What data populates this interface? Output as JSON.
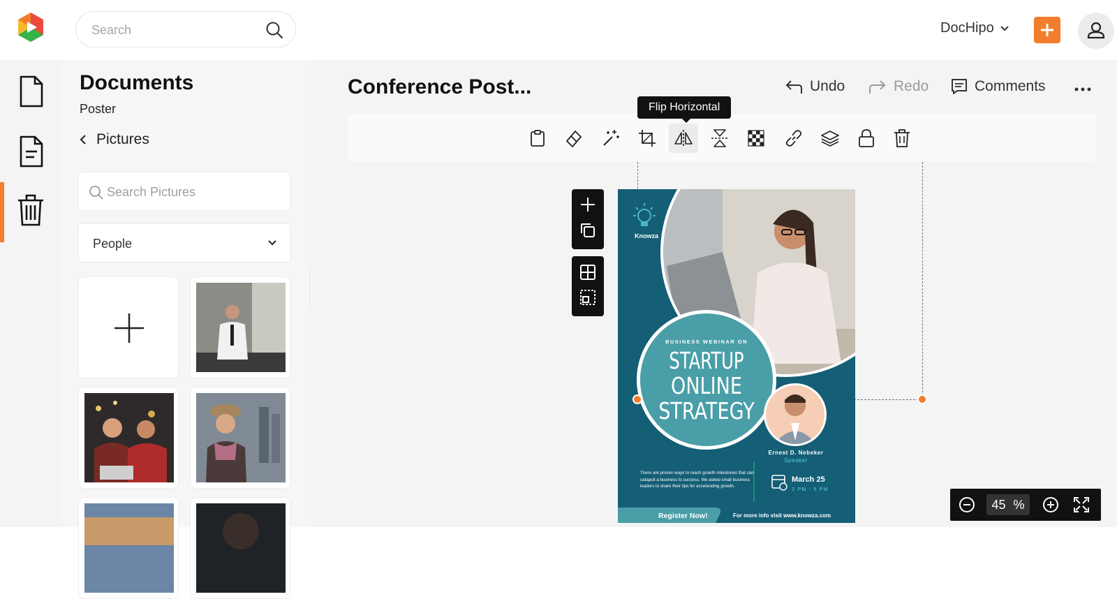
{
  "header": {
    "search_placeholder": "Search",
    "brand_label": "DocHipo",
    "accent": "#f27d2c"
  },
  "panel": {
    "title": "Documents",
    "subtitle": "Poster",
    "back_label": "Pictures",
    "search_placeholder": "Search Pictures",
    "category_value": "People"
  },
  "document": {
    "title": "Conference Post...",
    "undo_label": "Undo",
    "redo_label": "Redo",
    "comments_label": "Comments"
  },
  "toolbar": {
    "tooltip": "Flip Horizontal"
  },
  "poster": {
    "brand": "Knowza",
    "kicker": "BUSINESS WEBINAR ON",
    "headline_1": "STARTUP",
    "headline_2": "ONLINE",
    "headline_3": "STRATEGY",
    "speaker_name": "Ernest D. Nebeker",
    "speaker_role": "Speaker",
    "body": "There are proven ways to reach growth milestones that can catapult a business to success. We asked small business leaders to share their tips for accelerating growth.",
    "date": "March 25",
    "time": "2 PM - 5 PM",
    "cta": "Register Now!",
    "footer": "For more info visit www.knowza.com"
  },
  "zoom": {
    "value": "45",
    "unit": "%"
  }
}
